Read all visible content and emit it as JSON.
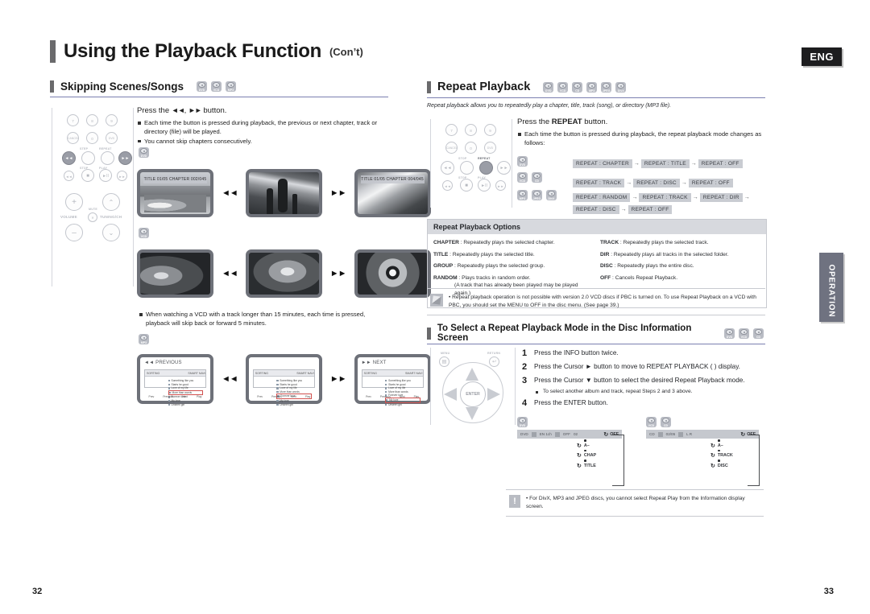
{
  "header": {
    "title": "Using the Playback Function",
    "title_suffix": "(Con’t)",
    "language_badge": "ENG"
  },
  "side_tab": {
    "label": "OPERATION"
  },
  "page_numbers": {
    "left": "32",
    "right": "33"
  },
  "left_column": {
    "section": {
      "heading": "Skipping Scenes/Songs",
      "discs": [
        "DVD",
        "VCD",
        "MP3"
      ]
    },
    "press_line": "Press the",
    "press_line_suffix": "button.",
    "skip_prev_glyph": "◄◄",
    "skip_next_glyph": "►►",
    "bullets": [
      "Each time the button is pressed during playback, the previous or next chapter, track or directory (file) will be played.",
      "You cannot skip chapters consecutively."
    ],
    "dvd_row": {
      "disc": "DVD",
      "screen_left_osd": "TITLE 01/05 CHAPTER 002/045",
      "screen_right_osd": "TITLE 01/05 CHAPTER 004/045"
    },
    "vcd_row": {
      "disc": "VCD",
      "note": "When watching a VCD with a track longer than 15 minutes, each time          is pressed, playback will skip back or forward 5 minutes."
    },
    "mp3_row": {
      "disc": "MP3",
      "screen_prev_label": "PREVIOUS",
      "screen_next_label": "NEXT",
      "panel_header_left": "SORTING",
      "panel_header_right": "SMART NAVI",
      "tracks": [
        "Something like you",
        "Starts he good",
        "Love of my life",
        "More than words",
        "Forever love",
        "My love",
        "Unseen girl"
      ],
      "selected_index_prev": 3,
      "selected_index_mid": 4,
      "selected_index_next": 5,
      "footer_buttons": [
        "Prev",
        "Previous",
        "Next",
        "Play"
      ]
    }
  },
  "right_column": {
    "section": {
      "heading": "Repeat Playback",
      "discs": [
        "DVD",
        "VCD",
        "CD",
        "MP3",
        "JPEG",
        "DivX"
      ],
      "intro": "Repeat playback allows you to repeatedly play a chapter, title, track (song), or directory (MP3 file)."
    },
    "press_repeat": {
      "prefix": "Press the",
      "bold": "REPEAT",
      "suffix": "button.",
      "bullet": "Each time the button is pressed during playback, the repeat playback mode changes as follows:"
    },
    "flows": [
      {
        "discs": [
          "DVD"
        ],
        "lines": [
          [
            "REPEAT : CHAPTER",
            "REPEAT : TITLE",
            "REPEAT : OFF"
          ]
        ]
      },
      {
        "discs": [
          "VCD",
          "CD"
        ],
        "lines": [
          [
            "REPEAT : TRACK",
            "REPEAT : DISC",
            "REPEAT : OFF"
          ]
        ]
      },
      {
        "discs": [
          "MP3",
          "JPEG",
          "DivX"
        ],
        "lines": [
          [
            "REPEAT : RANDOM",
            "REPEAT : TRACK",
            "REPEAT : DIR"
          ],
          [
            "REPEAT : DISC",
            "REPEAT : OFF"
          ]
        ]
      }
    ],
    "options_table": {
      "title": "Repeat Playback Options",
      "left": [
        {
          "term": "CHAPTER",
          "desc": ": Repeatedly plays the selected chapter."
        },
        {
          "term": "TITLE",
          "desc": ": Repeatedly plays the selected title."
        },
        {
          "term": "GROUP",
          "desc": ": Repeatedly plays the selected group."
        },
        {
          "term": "RANDOM",
          "desc": ": Plays tracks in random order.",
          "indent": "(A track that has already been played may be played again.)"
        }
      ],
      "right": [
        {
          "term": "TRACK",
          "desc": ": Repeatedly plays the selected track."
        },
        {
          "term": "DIR",
          "desc": ": Repeatedly plays all tracks in the selected folder."
        },
        {
          "term": "DISC",
          "desc": ": Repeatedly plays the entire disc."
        },
        {
          "term": "OFF",
          "desc": ": Cancels Repeat Playback."
        }
      ]
    },
    "note": "Repeat playback operation is not possible with version 2.0 VCD discs if PBC is turned on. To use Repeat Playback on a VCD with PBC, you should set the MENU to OFF in the disc menu. (See page 39.)",
    "mode_section": {
      "heading": "To Select a Repeat Playback Mode in the Disc Information Screen",
      "discs": [
        "DVD",
        "VCD",
        "CD"
      ],
      "steps": [
        {
          "n": "1",
          "text": "Press the INFO button twice.",
          "bold": "INFO"
        },
        {
          "n": "2",
          "text": "Press the Cursor ► button to move to REPEAT PLAYBACK (  ) display."
        },
        {
          "n": "3",
          "text": "Press the Cursor ▼ button to select the desired Repeat Playback mode.",
          "sub": "To select another album and track, repeat Steps 2 and 3 above."
        },
        {
          "n": "4",
          "text": "Press the ENTER button.",
          "bold": "ENTER"
        }
      ],
      "remote_labels": {
        "menu": "MENU",
        "return": "RETURN",
        "enter": "ENTER"
      }
    },
    "osd_examples": [
      {
        "discs": [
          "DVD"
        ],
        "bar_items": [
          "DVD",
          "EN 1ch",
          "EN 1ch",
          "OFF",
          "02"
        ],
        "bar_right": "OFF",
        "chain": [
          "OFF",
          "A–",
          "CHAP",
          "TITLE"
        ]
      },
      {
        "discs": [
          "VCD",
          "CD"
        ],
        "bar_items": [
          "CD",
          "02/05",
          "L R"
        ],
        "bar_right": "OFF",
        "chain": [
          "OFF",
          "A–",
          "TRACK",
          "DISC"
        ]
      }
    ],
    "warning": "For DivX, MP3 and JPEG discs, you cannot select Repeat Play from the Information display screen."
  }
}
